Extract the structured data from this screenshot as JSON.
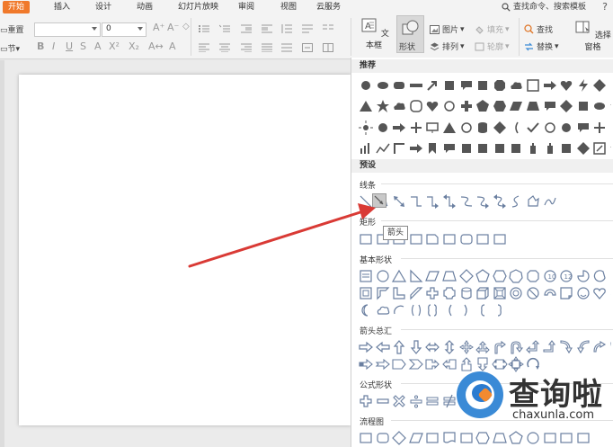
{
  "menu": {
    "tabs": [
      "开始",
      "插入",
      "设计",
      "动画",
      "幻灯片放映",
      "审阅",
      "视图",
      "云服务"
    ],
    "search_text": "查找命令、搜索模板",
    "help": "?"
  },
  "ribbon": {
    "reset_label": "重置",
    "section_label": "节",
    "font_size_value": "0",
    "textbox_label": "文本框",
    "shapes_label": "形状",
    "picture_label": "图片",
    "fill_label": "填充",
    "arrange_label": "排列",
    "outline_label": "轮廓",
    "find_label": "查找",
    "replace_label": "替换",
    "selection_pane_label": "选择窗格"
  },
  "panel": {
    "sections": {
      "recommended": "推荐",
      "preset": "预设"
    },
    "categories": {
      "lines": "线条",
      "rectangles": "矩形",
      "basic": "基本形状",
      "arrows": "箭头总汇",
      "formula": "公式形状",
      "flowchart": "流程图"
    },
    "tooltip": "箭头"
  },
  "watermark": {
    "cn": "查询啦",
    "en": "chaxunla.com"
  },
  "colors": {
    "accent": "#f0792b",
    "annotation_arrow": "#d93a35",
    "watermark_blue": "#3a8ad6",
    "watermark_orange": "#f28a30"
  }
}
